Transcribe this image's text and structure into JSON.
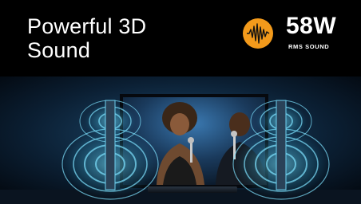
{
  "headline": {
    "line1": "Powerful 3D",
    "line2": "Sound"
  },
  "power": {
    "value": "58W",
    "unit": "RMS SOUND"
  },
  "icons": {
    "badge": "waveform-icon"
  },
  "colors": {
    "badge": "#f39a1b",
    "background": "#000000",
    "glow": "#4fd6ff"
  }
}
